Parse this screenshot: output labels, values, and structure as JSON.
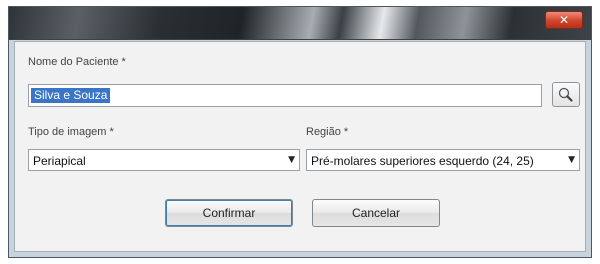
{
  "window": {
    "close_glyph": "✕"
  },
  "form": {
    "patient_label": "Nome do Paciente *",
    "patient_value": "Silva e Souza",
    "search_icon": "magnifier-icon",
    "image_type_label": "Tipo de imagem *",
    "image_type_value": "Periapical",
    "region_label": "Região *",
    "region_value": "Pré-molares superiores esquerdo (24, 25)",
    "dropdown_arrow": "▼"
  },
  "buttons": {
    "confirm_label": "Confirmar",
    "cancel_label": "Cancelar"
  },
  "colors": {
    "selection": "#3b75c8",
    "close_button": "#d0452c"
  }
}
